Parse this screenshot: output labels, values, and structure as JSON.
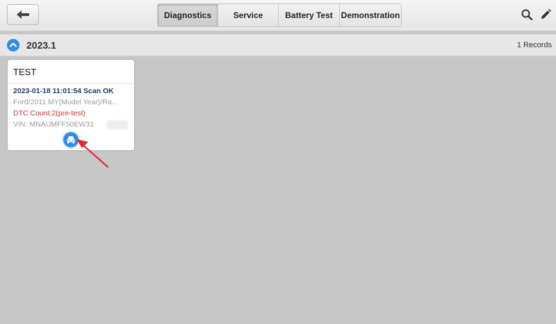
{
  "header": {
    "tabs": [
      {
        "label": "Diagnostics",
        "active": true
      },
      {
        "label": "Service",
        "active": false
      },
      {
        "label": "Battery Test",
        "active": false
      },
      {
        "label": "Demonstration",
        "active": false
      }
    ],
    "icons": {
      "back": "back-arrow-icon",
      "search": "search-icon",
      "edit": "pencil-icon"
    }
  },
  "group": {
    "title": "2023.1",
    "records": "1 Records",
    "expanded": true
  },
  "record": {
    "title": "TEST",
    "date_line": "2023-01-18 11:01:54 Scan OK",
    "vehicle_line": "Ford/2011 MY(Model Year)/Ra...",
    "dtc_line": "DTC Count:2(pre-test)",
    "vin_line": "VIN: MNAUMFF50EW31"
  },
  "colors": {
    "accent": "#2f8ee4",
    "dtc": "#d42a2a",
    "date": "#1f3a66",
    "annotation": "#e32b2b"
  }
}
